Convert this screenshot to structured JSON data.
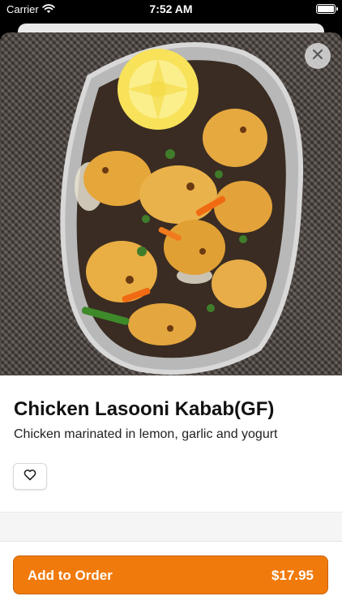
{
  "status_bar": {
    "carrier": "Carrier",
    "time": "7:52 AM",
    "battery_level": 1.0
  },
  "item": {
    "title": "Chicken Lasooni Kabab(GF)",
    "description": "Chicken marinated in lemon, garlic and yogurt",
    "image_icon": "food-photo"
  },
  "actions": {
    "close_icon": "close-icon",
    "favorite_icon": "heart-outline-icon"
  },
  "order": {
    "label": "Add to Order",
    "price": "$17.95"
  },
  "colors": {
    "accent": "#f07a0b",
    "accent_border": "#c8620a"
  }
}
